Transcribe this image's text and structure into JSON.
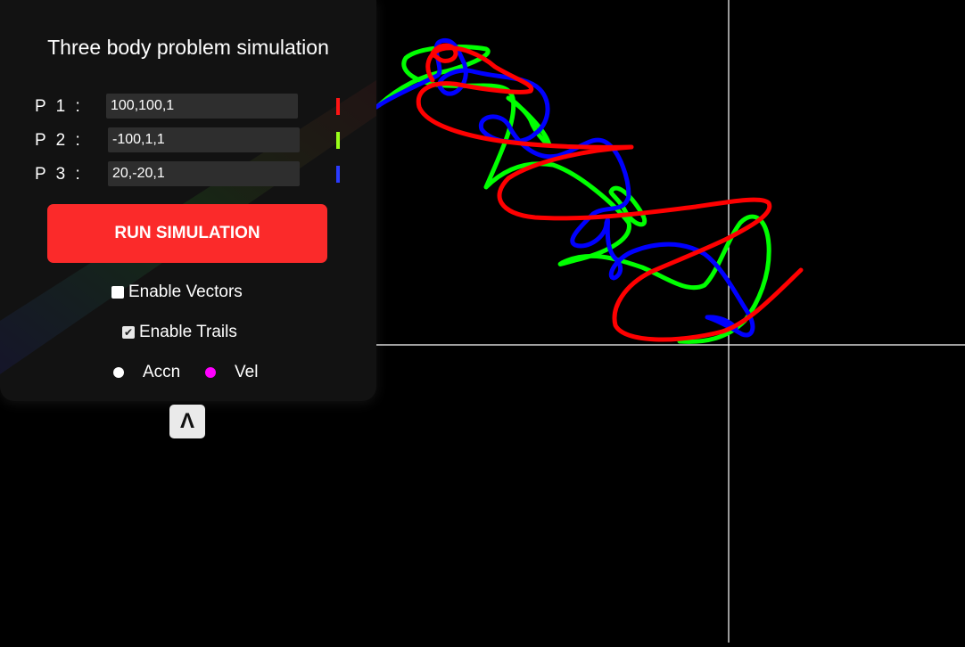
{
  "panel": {
    "title": "Three body problem simulation",
    "bodies": [
      {
        "label": "P 1 :",
        "value": "100,100,1",
        "color": "#ff1414"
      },
      {
        "label": "P 2 :",
        "value": "-100,1,1",
        "color": "#9bff1a"
      },
      {
        "label": "P 3 :",
        "value": "20,-20,1",
        "color": "#2a3bff"
      }
    ],
    "run_label": "RUN SIMULATION",
    "enable_vectors_label": "Enable Vectors",
    "enable_vectors_checked": false,
    "enable_trails_label": "Enable Trails",
    "enable_trails_checked": true,
    "legend": [
      {
        "label": "Accn",
        "color": "#ffffff"
      },
      {
        "label": "Vel",
        "color": "#ff00ff"
      }
    ],
    "collapse_icon": "Λ"
  },
  "trail_colors": {
    "red": "#ff0000",
    "green": "#00ff00",
    "blue": "#0000ff"
  }
}
